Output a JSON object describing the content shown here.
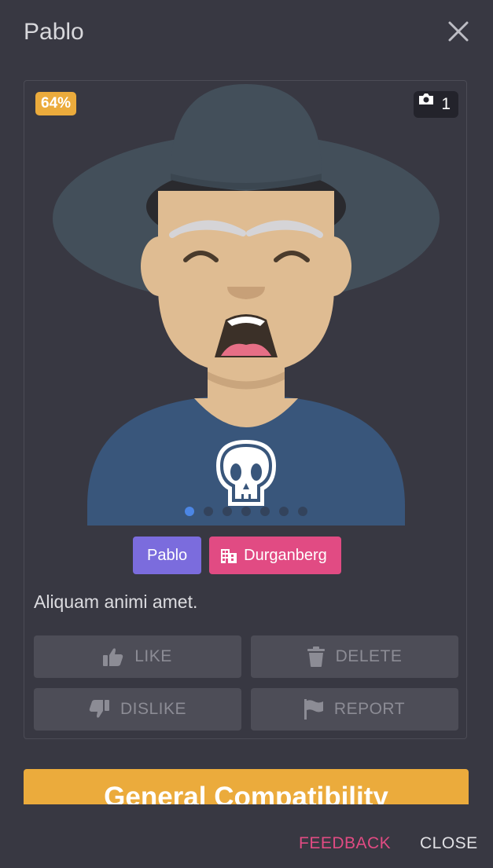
{
  "header": {
    "title": "Pablo",
    "close_icon": "close-icon"
  },
  "card": {
    "compatibility_badge": "64%",
    "photo_count": "1",
    "carousel": {
      "total": 7,
      "active_index": 0
    },
    "tags": {
      "name": "Pablo",
      "location": "Durganberg",
      "location_icon": "building-icon"
    },
    "bio": "Aliquam animi amet.",
    "actions": {
      "like": "LIKE",
      "delete": "DELETE",
      "dislike": "DISLIKE",
      "report": "REPORT"
    }
  },
  "compatibility_section": {
    "title": "General Compatibility"
  },
  "footer": {
    "feedback": "FEEDBACK",
    "close": "CLOSE"
  },
  "colors": {
    "background": "#383842",
    "accent_orange": "#ebab3c",
    "tag_purple": "#7b6cdd",
    "tag_pink": "#e14b83",
    "button_gray": "#4d4d57"
  }
}
